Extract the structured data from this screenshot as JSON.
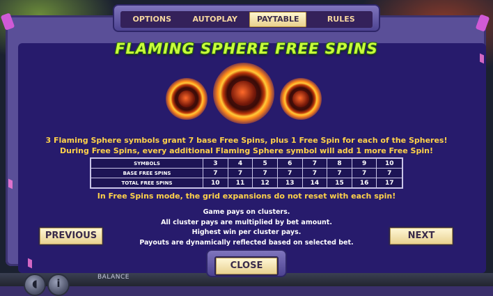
{
  "tabs": [
    {
      "label": "OPTIONS"
    },
    {
      "label": "AUTOPLAY"
    },
    {
      "label": "PAYTABLE"
    },
    {
      "label": "RULES"
    }
  ],
  "active_tab": "PAYTABLE",
  "title": "FLAMING SPHERE FREE SPINS",
  "description": [
    "3 Flaming Sphere symbols grant 7 base Free Spins, plus 1 Free Spin for each of the Spheres!",
    "During Free Spins, every additional Flaming Sphere symbol will add 1 more Free Spin!"
  ],
  "table": {
    "rows": [
      {
        "label": "SYMBOLS",
        "values": [
          "3",
          "4",
          "5",
          "6",
          "7",
          "8",
          "9",
          "10"
        ]
      },
      {
        "label": "BASE FREE SPINS",
        "values": [
          "7",
          "7",
          "7",
          "7",
          "7",
          "7",
          "7",
          "7"
        ]
      },
      {
        "label": "TOTAL FREE SPINS",
        "values": [
          "10",
          "11",
          "12",
          "13",
          "14",
          "15",
          "16",
          "17"
        ]
      }
    ]
  },
  "note": "In Free Spins mode, the grid expansions do not reset with each spin!",
  "info_lines": [
    "Game pays on clusters.",
    "All cluster pays are multiplied by bet amount.",
    "Highest win per cluster pays.",
    "Payouts are dynamically reflected based on selected bet."
  ],
  "buttons": {
    "previous": "PREVIOUS",
    "next": "NEXT",
    "close": "CLOSE"
  },
  "bottom": {
    "balance_label": "BALANCE"
  },
  "icons": [
    "flaming-sphere-icon",
    "sound-icon",
    "info-icon"
  ],
  "colors": {
    "title": "#c9ff3a",
    "description": "#ffd24a",
    "panel": "#271b6c",
    "button": "#f3e2a8"
  }
}
